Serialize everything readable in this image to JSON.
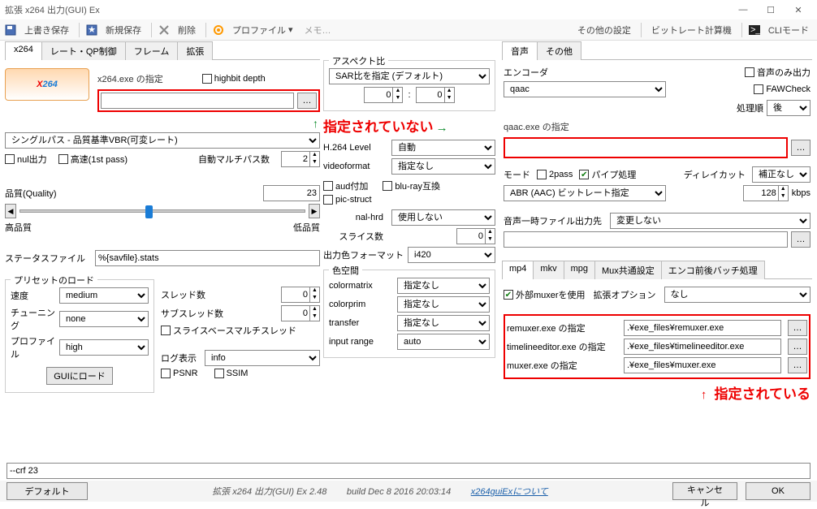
{
  "window": {
    "title": "拡張 x264 出力(GUI) Ex"
  },
  "toolbar": {
    "overwrite_save": "上書き保存",
    "new_save": "新規保存",
    "delete": "削除",
    "profile": "プロファイル",
    "memo": "メモ…",
    "other_settings": "その他の設定",
    "bitrate_calc": "ビットレート計算機",
    "cli_mode": "CLIモード"
  },
  "tabs_left": {
    "x264": "x264",
    "rate": "レート・QP制御",
    "frame": "フレーム",
    "ext": "拡張"
  },
  "x264": {
    "exe_label": "x264.exe の指定",
    "highbit": "highbit depth",
    "exe_value": "",
    "pass_select": "シングルパス - 品質基準VBR(可変レート)",
    "nul_out": "nul出力",
    "fast_1stpass": "高速(1st pass)",
    "auto_multipass": "自動マルチパス数",
    "auto_multipass_value": "2",
    "quality_label": "品質(Quality)",
    "quality_value": "23",
    "hq_label": "高品質",
    "lq_label": "低品質",
    "status_file_label": "ステータスファイル",
    "status_file_value": "%{savfile}.stats"
  },
  "preset": {
    "group": "プリセットのロード",
    "speed_label": "速度",
    "speed_value": "medium",
    "tuning_label": "チューニング",
    "tuning_value": "none",
    "profile_label": "プロファイル",
    "profile_value": "high",
    "load_btn": "GUIにロード",
    "threads_label": "スレッド数",
    "threads_value": "0",
    "subthreads_label": "サブスレッド数",
    "subthreads_value": "0",
    "slice_base": "スライスベースマルチスレッド",
    "log_label": "ログ表示",
    "log_value": "info",
    "psnr": "PSNR",
    "ssim": "SSIM"
  },
  "aspect": {
    "group": "アスペクト比",
    "sar_select": "SAR比を指定 (デフォルト)",
    "sar_w": "0",
    "sar_h": "0",
    "h264_level_label": "H.264 Level",
    "h264_level": "自動",
    "videoformat_label": "videoformat",
    "videoformat": "指定なし",
    "aud": "aud付加",
    "bluray": "blu-ray互換",
    "picstruct": "pic-struct",
    "nalhrd_label": "nal-hrd",
    "nalhrd": "使用しない",
    "slice_label": "スライス数",
    "slice_value": "0",
    "outfmt_label": "出力色フォーマット",
    "outfmt": "i420"
  },
  "colorspace": {
    "group": "色空間",
    "colormatrix_label": "colormatrix",
    "colormatrix": "指定なし",
    "colorprim_label": "colorprim",
    "colorprim": "指定なし",
    "transfer_label": "transfer",
    "transfer": "指定なし",
    "inputrange_label": "input range",
    "inputrange": "auto"
  },
  "annot": {
    "not_specified": "指定されていない",
    "specified": "指定されている"
  },
  "tabs_right": {
    "audio": "音声",
    "other": "その他"
  },
  "audio": {
    "encoder_label": "エンコーダ",
    "encoder": "qaac",
    "audio_only": "音声のみ出力",
    "faw_check": "FAWCheck",
    "proc_order_label": "処理順",
    "proc_order": "後",
    "exe_label": "qaac.exe の指定",
    "exe_value": "",
    "mode_label": "モード",
    "twopass": "2pass",
    "pipe": "パイプ処理",
    "delay_label": "ディレイカット",
    "delay": "補正なし",
    "bitrate_select": "ABR (AAC) ビットレート指定",
    "bitrate_value": "128",
    "bitrate_unit": "kbps",
    "tmpfile_label": "音声一時ファイル出力先",
    "tmpfile_opt": "変更しない",
    "tmpfile_value": ""
  },
  "tabs_mux": {
    "mp4": "mp4",
    "mkv": "mkv",
    "mpg": "mpg",
    "mux_common": "Mux共通設定",
    "enc_batch": "エンコ前後バッチ処理"
  },
  "mux": {
    "ext_muxer": "外部muxerを使用",
    "ext_opt_label": "拡張オプション",
    "ext_opt": "なし",
    "remuxer_label": "remuxer.exe の指定",
    "remuxer_value": ".¥exe_files¥remuxer.exe",
    "timeline_label": "timelineeditor.exe の指定",
    "timeline_value": ".¥exe_files¥timelineeditor.exe",
    "muxer_label": "muxer.exe の指定",
    "muxer_value": ".¥exe_files¥muxer.exe"
  },
  "footer": {
    "cmd": "--crf 23",
    "default_btn": "デフォルト",
    "version": "拡張 x264 出力(GUI) Ex 2.48",
    "build": "build Dec  8 2016 20:03:14",
    "about": "x264guiExについて",
    "cancel": "キャンセル",
    "ok": "OK"
  }
}
